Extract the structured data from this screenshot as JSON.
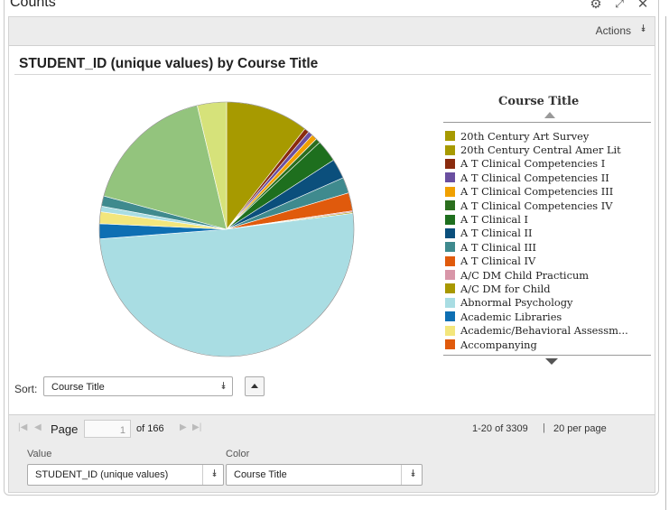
{
  "window": {
    "title": "Counts",
    "icons": [
      "gear-icon",
      "expand-icon",
      "close-icon"
    ]
  },
  "actions": {
    "label": "Actions",
    "caret": "⯯"
  },
  "chart": {
    "title": "STUDENT_ID (unique values) by Course Title"
  },
  "legend": {
    "title": "Course Title",
    "items": [
      {
        "label": "20th Century Art Survey",
        "color": "#a79a00"
      },
      {
        "label": "20th Century Central Amer Lit",
        "color": "#a79a00"
      },
      {
        "label": "A T Clinical Competencies I",
        "color": "#8a2b0e"
      },
      {
        "label": "A T Clinical Competencies II",
        "color": "#6a4fa0"
      },
      {
        "label": "A T Clinical Competencies III",
        "color": "#f0a000"
      },
      {
        "label": "A T Clinical Competencies IV",
        "color": "#2b6e1e"
      },
      {
        "label": "A T Clinical I",
        "color": "#1e6f1e"
      },
      {
        "label": "A T Clinical II",
        "color": "#0b4f7c"
      },
      {
        "label": "A T Clinical III",
        "color": "#3f8a8e"
      },
      {
        "label": "A T Clinical IV",
        "color": "#e05a0c"
      },
      {
        "label": "A/C DM Child Practicum",
        "color": "#d896a8"
      },
      {
        "label": "A/C DM for Child",
        "color": "#a89800"
      },
      {
        "label": "Abnormal Psychology",
        "color": "#a9dde3"
      },
      {
        "label": "Academic Libraries",
        "color": "#0e6fb3"
      },
      {
        "label": "Academic/Behavioral Assessm...",
        "color": "#f3e67c"
      },
      {
        "label": "Accompanying",
        "color": "#e05a0c"
      }
    ]
  },
  "chart_data": {
    "type": "pie",
    "title": "STUDENT_ID (unique values) by Course Title",
    "slices": [
      {
        "label": "20th Century Art Survey",
        "value": 10.5,
        "color": "#a79a00"
      },
      {
        "label": "A T Clinical Competencies I",
        "value": 0.6,
        "color": "#8a2b0e"
      },
      {
        "label": "A T Clinical Competencies II",
        "value": 0.6,
        "color": "#6a4fa0"
      },
      {
        "label": "A T Clinical Competencies III",
        "value": 0.7,
        "color": "#f0a000"
      },
      {
        "label": "A T Clinical Competencies IV",
        "value": 0.6,
        "color": "#2b6e1e"
      },
      {
        "label": "A T Clinical I",
        "value": 2.8,
        "color": "#1e6f1e"
      },
      {
        "label": "A T Clinical II",
        "value": 2.5,
        "color": "#0b4f7c"
      },
      {
        "label": "A T Clinical III",
        "value": 2.0,
        "color": "#3f8a8e"
      },
      {
        "label": "A T Clinical IV",
        "value": 2.3,
        "color": "#e05a0c"
      },
      {
        "label": "A/C DM Child Practicum",
        "value": 0.15,
        "color": "#d896a8"
      },
      {
        "label": "A/C DM for Child",
        "value": 0.15,
        "color": "#a89800"
      },
      {
        "label": "Abnormal Psychology",
        "value": 50.6,
        "color": "#a9dde3"
      },
      {
        "label": "Academic Libraries",
        "value": 1.9,
        "color": "#0e6fb3"
      },
      {
        "label": "Academic/Behavioral Assessm...",
        "value": 1.5,
        "color": "#f3e67c"
      },
      {
        "label": "",
        "value": 0.7,
        "color": "#a9dde3"
      },
      {
        "label": "",
        "value": 1.3,
        "color": "#3f8a8e"
      },
      {
        "label": "",
        "value": 17.0,
        "color": "#93c47d"
      },
      {
        "label": "",
        "value": 3.7,
        "color": "#d6e27a"
      }
    ]
  },
  "sort": {
    "label": "Sort:",
    "value": "Course Title"
  },
  "pager": {
    "page_label": "Page",
    "page_value": "1",
    "of": "of 166",
    "range": "1-20 of 3309",
    "sep": "|",
    "per_page": "20 per page"
  },
  "fields": {
    "value_label": "Value",
    "value": "STUDENT_ID (unique values)",
    "color_label": "Color",
    "color": "Course Title"
  }
}
